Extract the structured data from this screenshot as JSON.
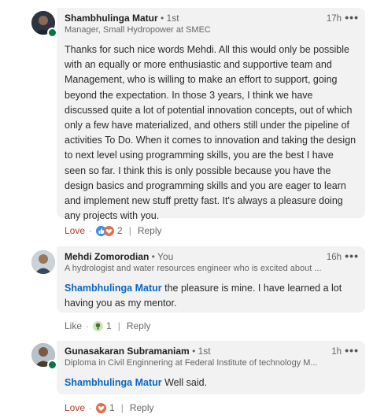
{
  "comments": [
    {
      "author": "Shambhulinga Matur",
      "degree": "• 1st",
      "headline": "Manager, Small Hydropower at SMEC",
      "time": "17h",
      "more": "•••",
      "mention": "",
      "text": "Thanks for such nice words Mehdi. All this would only be possible with an equally or more enthusiastic and supportive team and Management, who is willing to make an effort to support, going beyond the expectation. In those 3 years, I think we have discussed quite a lot of potential innovation concepts, out of which only a few have materialized, and others still under the pipeline of activities To Do.  When it comes to innovation and taking the design to next level using programming skills, you are the best I have seen so far. I think this is only possible because you have the design basics and programming skills and you are eager to learn and implement new stuff pretty fast. It's always a pleasure doing any projects with you.",
      "reaction_label": "Love",
      "dot": "·",
      "reaction_count": "2",
      "pipe": "|",
      "reply_label": "Reply"
    },
    {
      "author": "Mehdi Zomorodian",
      "degree": "• You",
      "headline": "A hydrologist and water resources engineer who is excited about ...",
      "time": "16h",
      "more": "•••",
      "mention": "Shambhulinga Matur",
      "text": " the pleasure is mine. I have learned a lot having you as my mentor.",
      "reaction_label": "Like",
      "dot": "·",
      "reaction_count": "1",
      "pipe": "|",
      "reply_label": "Reply"
    },
    {
      "author": "Gunasakaran Subramaniam",
      "degree": "• 1st",
      "headline": "Diploma in Civil Enginnering at Federal Institute of technology M...",
      "time": "1h",
      "more": "•••",
      "mention": "Shambhulinga Matur",
      "text": " Well said.",
      "reaction_label": "Love",
      "dot": "·",
      "reaction_count": "1",
      "pipe": "|",
      "reply_label": "Reply"
    }
  ],
  "colors": {
    "bubble": "#f2f2f2",
    "mention": "#0a66c2",
    "love": "#c0392b",
    "like_blue": "#378fe9",
    "insightful_green": "#44712e",
    "online": "#057642"
  },
  "icons": {
    "reactions_1": [
      "like-reaction-icon",
      "love-reaction-icon"
    ],
    "reactions_2": [
      "insightful-reaction-icon"
    ],
    "reactions_3": [
      "love-reaction-icon"
    ]
  }
}
